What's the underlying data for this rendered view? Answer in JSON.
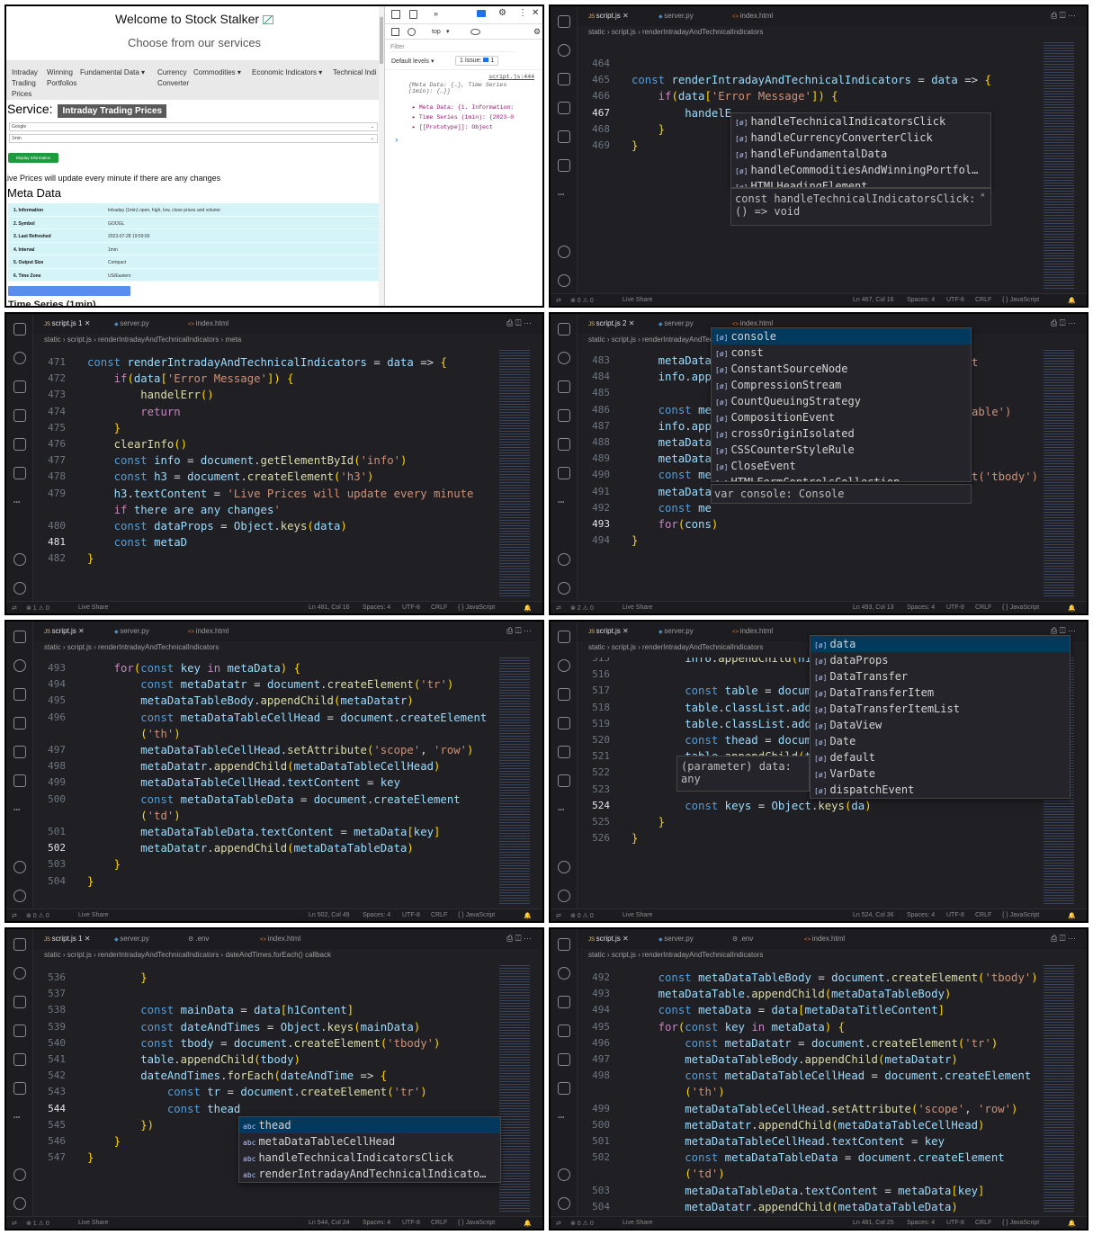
{
  "browser": {
    "title": "Welcome to Stock Stalker",
    "title_icon": "chart-increasing-icon",
    "subtitle": "Choose from our services",
    "nav": [
      {
        "label": "Intraday Trading Prices",
        "lines": [
          "Intraday",
          "Trading",
          "Prices"
        ]
      },
      {
        "label": "Winning Portfolios",
        "lines": [
          "Winning",
          "Portfolios"
        ]
      },
      {
        "label": "Fundamental Data ▾",
        "lines": [
          "Fundamental Data ▾"
        ]
      },
      {
        "label": "Currency Converter",
        "lines": [
          "Currency",
          "Converter"
        ]
      },
      {
        "label": "Commodities ▾",
        "lines": [
          "Commodities ▾"
        ]
      },
      {
        "label": "Economic Indicators ▾",
        "lines": [
          "Economic Indicators ▾"
        ]
      },
      {
        "label": "Technical Indi",
        "lines": [
          "Technical Indi"
        ]
      }
    ],
    "service_label": "Service:",
    "service_name": "Intraday Trading Prices",
    "select1": "Google",
    "select2": "1min",
    "display_button": "Display Information",
    "live_note": "Live Prices will update every minute if there are any changes",
    "meta_heading": "Meta Data",
    "meta_rows": [
      {
        "key": "1. Information",
        "value": "Intraday (1min) open, high, low, close prices and volume"
      },
      {
        "key": "2. Symbol",
        "value": "GOOGL"
      },
      {
        "key": "3. Last Refreshed",
        "value": "2023-07-28 19:59:00"
      },
      {
        "key": "4. Interval",
        "value": "1min"
      },
      {
        "key": "5. Output Size",
        "value": "Compact"
      },
      {
        "key": "6. Time Zone",
        "value": "US/Eastern"
      }
    ],
    "next_heading": "Time Series (1min)"
  },
  "devtools": {
    "context": "top",
    "filter_placeholder": "Filter",
    "levels": "Default levels ▾",
    "issues": "1 Issue:",
    "issue_count": "1",
    "source": "script.js:444",
    "log_summary": "{Meta Data: {…}, Time Series (1min): {…}}",
    "entries": [
      "▸ Meta Data: {1. Information:",
      "▸ Time Series (1min): {2023-0",
      "▸ [[Prototype]]: Object"
    ],
    "prompt": "›"
  },
  "status": {
    "live": "Live Share",
    "spaces": "Spaces: 4",
    "enc": "UTF-8",
    "eol": "CRLF",
    "lang": "{ } JavaScript",
    "cursors": [
      "Ln 467, Col 16",
      "Ln 481, Col 16",
      "Ln 493, Col 13",
      "Ln 502, Col 49",
      "Ln 524, Col 36",
      "Ln 544, Col 24",
      "Ln 481, Col 25"
    ],
    "problems": [
      "⊗ 0 ⚠ 0",
      "⊗ 1 ⚠ 0",
      "⊗ 2 ⚠ 0",
      "⊗ 0 ⚠ 0",
      "⊗ 0 ⚠ 0",
      "⊗ 1 ⚠ 0",
      "⊗ 0 ⚠ 0"
    ]
  },
  "tabs": {
    "script": "script.js",
    "server": "server.py",
    "index": "index.html",
    "env": ".env",
    "mod1": "1",
    "mod2": "2"
  },
  "crumbs": {
    "static": "static",
    "file": "script.js",
    "fn": "renderIntradayAndTechnicalIndicators",
    "meta": "meta",
    "cb": "dateAndTimes.forEach() callback"
  },
  "p2": {
    "lines": [
      {
        "n": "464",
        "t": ""
      },
      {
        "n": "465",
        "t": "const renderIntradayAndTechnicalIndicators = data => {"
      },
      {
        "n": "466",
        "t": "    if(data['Error Message']) {"
      },
      {
        "n": "467",
        "t": "        handelE"
      },
      {
        "n": "468",
        "t": "    }"
      },
      {
        "n": "469",
        "t": "}"
      }
    ],
    "suggest": [
      "handleTechnicalIndicatorsClick",
      "handleCurrencyConverterClick",
      "handleFundamentalData",
      "handleCommoditiesAndWinningPortfol…",
      "HTMLHeadingElement"
    ],
    "doc": "const handleTechnicalIndicatorsClick: () => void"
  },
  "p3": {
    "lines": [
      {
        "n": "471",
        "t": "const renderIntradayAndTechnicalIndicators = data => {"
      },
      {
        "n": "472",
        "t": "    if(data['Error Message']) {"
      },
      {
        "n": "473",
        "t": "        handelErr()"
      },
      {
        "n": "474",
        "t": "        return"
      },
      {
        "n": "475",
        "t": "    }"
      },
      {
        "n": "476",
        "t": "    clearInfo()"
      },
      {
        "n": "477",
        "t": "    const info = document.getElementById('info')"
      },
      {
        "n": "478",
        "t": "    const h3 = document.createElement('h3')"
      },
      {
        "n": "479",
        "t": "    h3.textContent = 'Live Prices will update every minute"
      },
      {
        "n": "",
        "t": "    if there are any changes'"
      },
      {
        "n": "480",
        "t": "    const dataProps = Object.keys(data)"
      },
      {
        "n": "481",
        "t": "    const metaD"
      },
      {
        "n": "482",
        "t": "}"
      }
    ]
  },
  "p4": {
    "lines": [
      {
        "n": "483",
        "t": "    metaData"
      },
      {
        "n": "484",
        "t": "    info.app"
      },
      {
        "n": "485",
        "t": ""
      },
      {
        "n": "486",
        "t": "    const me"
      },
      {
        "n": "487",
        "t": "    info.app"
      },
      {
        "n": "488",
        "t": "    metaData"
      },
      {
        "n": "489",
        "t": "    metaData"
      },
      {
        "n": "490",
        "t": "    const me"
      },
      {
        "n": "491",
        "t": "    metaData"
      },
      {
        "n": "492",
        "t": "    const me"
      },
      {
        "n": "493",
        "t": "    for(cons)"
      },
      {
        "n": "494",
        "t": "}"
      }
    ],
    "right_frags": [
      {
        "row": 0,
        "t": "t"
      },
      {
        "row": 3,
        "t": "able')"
      },
      {
        "row": 7,
        "t": "t('tbody')"
      }
    ],
    "suggest": [
      "console",
      "const",
      "ConstantSourceNode",
      "CompressionStream",
      "CountQueuingStrategy",
      "CompositionEvent",
      "crossOriginIsolated",
      "CSSCounterStyleRule",
      "CloseEvent",
      "HTMLFormControlsCollection"
    ],
    "doc": "var console: Console"
  },
  "p5": {
    "lines": [
      {
        "n": "493",
        "t": "    for(const key in metaData) {"
      },
      {
        "n": "494",
        "t": "        const metaDatatr = document.createElement('tr')"
      },
      {
        "n": "495",
        "t": "        metaDataTableBody.appendChild(metaDatatr)"
      },
      {
        "n": "496",
        "t": "        const metaDataTableCellHead = document.createElement"
      },
      {
        "n": "",
        "t": "        ('th')"
      },
      {
        "n": "497",
        "t": "        metaDataTableCellHead.setAttribute('scope', 'row')"
      },
      {
        "n": "498",
        "t": "        metaDatatr.appendChild(metaDataTableCellHead)"
      },
      {
        "n": "499",
        "t": "        metaDataTableCellHead.textContent = key"
      },
      {
        "n": "500",
        "t": "        const metaDataTableData = document.createElement"
      },
      {
        "n": "",
        "t": "        ('td')"
      },
      {
        "n": "501",
        "t": "        metaDataTableData.textContent = metaData[key]"
      },
      {
        "n": "502",
        "t": "        metaDatatr.appendChild(metaDataTableData)"
      },
      {
        "n": "503",
        "t": "    }"
      },
      {
        "n": "504",
        "t": "}"
      }
    ]
  },
  "p6": {
    "lines": [
      {
        "n": "515",
        "t": "        info.appendChild(h1"
      },
      {
        "n": "516",
        "t": ""
      },
      {
        "n": "517",
        "t": "        const table = docum"
      },
      {
        "n": "518",
        "t": "        table.classList.add"
      },
      {
        "n": "519",
        "t": "        table.classList.add"
      },
      {
        "n": "520",
        "t": "        const thead = docum"
      },
      {
        "n": "521",
        "t": "        table.appendChild(t"
      },
      {
        "n": "522",
        "t": ""
      },
      {
        "n": "523",
        "t": ""
      },
      {
        "n": "524",
        "t": "        const keys = Object.keys(da)"
      },
      {
        "n": "525",
        "t": "    }"
      },
      {
        "n": "526",
        "t": "}"
      }
    ],
    "suggest": [
      "data",
      "dataProps",
      "DataTransfer",
      "DataTransferItem",
      "DataTransferItemList",
      "DataView",
      "Date",
      "default",
      "VarDate",
      "dispatchEvent"
    ],
    "param": "(parameter) data:",
    "param2": "any"
  },
  "p7": {
    "lines": [
      {
        "n": "536",
        "t": "        }"
      },
      {
        "n": "537",
        "t": ""
      },
      {
        "n": "538",
        "t": "        const mainData = data[h1Content]"
      },
      {
        "n": "539",
        "t": "        const dateAndTimes = Object.keys(mainData)"
      },
      {
        "n": "540",
        "t": "        const tbody = document.createElement('tbody')"
      },
      {
        "n": "541",
        "t": "        table.appendChild(tbody)"
      },
      {
        "n": "542",
        "t": "        dateAndTimes.forEach(dateAndTime => {"
      },
      {
        "n": "543",
        "t": "            const tr = document.createElement('tr')"
      },
      {
        "n": "544",
        "t": "            const thead"
      },
      {
        "n": "545",
        "t": "        })"
      },
      {
        "n": "546",
        "t": "    }"
      },
      {
        "n": "547",
        "t": "}"
      }
    ],
    "suggest": [
      "thead",
      "metaDataTableCellHead",
      "handleTechnicalIndicatorsClick",
      "renderIntradayAndTechnicalIndicato…"
    ]
  },
  "p8": {
    "lines": [
      {
        "n": "492",
        "t": "    const metaDataTableBody = document.createElement('tbody')"
      },
      {
        "n": "493",
        "t": "    metaDataTable.appendChild(metaDataTableBody)"
      },
      {
        "n": "494",
        "t": "    const metaData = data[metaDataTitleContent]"
      },
      {
        "n": "495",
        "t": "    for(const key in metaData) {"
      },
      {
        "n": "496",
        "t": "        const metaDatatr = document.createElement('tr')"
      },
      {
        "n": "497",
        "t": "        metaDataTableBody.appendChild(metaDatatr)"
      },
      {
        "n": "498",
        "t": "        const metaDataTableCellHead = document.createElement"
      },
      {
        "n": "",
        "t": "        ('th')"
      },
      {
        "n": "499",
        "t": "        metaDataTableCellHead.setAttribute('scope', 'row')"
      },
      {
        "n": "500",
        "t": "        metaDatatr.appendChild(metaDataTableCellHead)"
      },
      {
        "n": "501",
        "t": "        metaDataTableCellHead.textContent = key"
      },
      {
        "n": "502",
        "t": "        const metaDataTableData = document.createElement"
      },
      {
        "n": "",
        "t": "        ('td')"
      },
      {
        "n": "503",
        "t": "        metaDataTableData.textContent = metaData[key]"
      },
      {
        "n": "504",
        "t": "        metaDatatr.appendChild(metaDataTableData)"
      }
    ]
  }
}
